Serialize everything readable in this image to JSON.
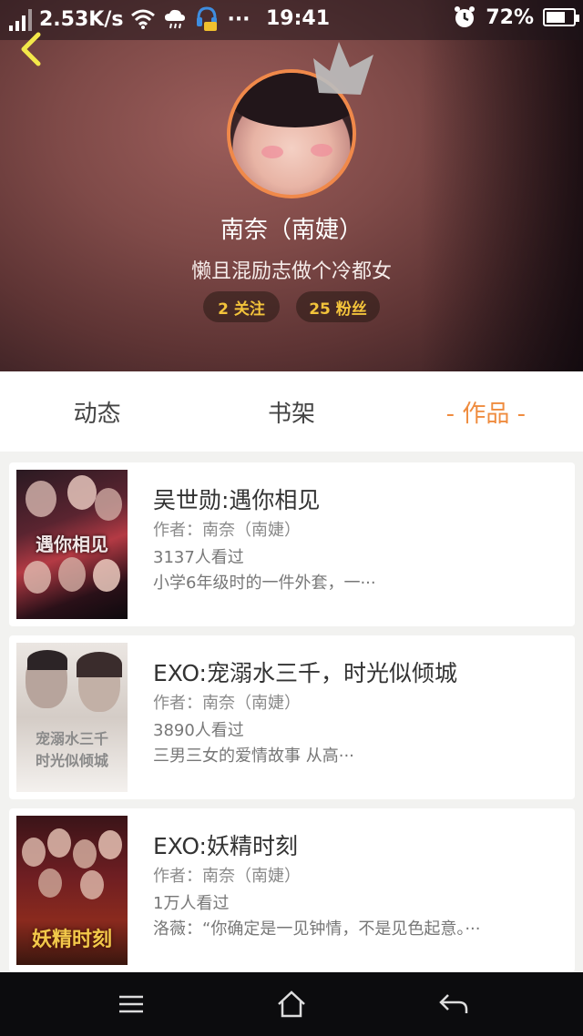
{
  "status": {
    "speed": "2.53K/s",
    "time": "19:41",
    "battery": "72%",
    "battery_level": 0.72,
    "dots": "···"
  },
  "profile": {
    "name": "南奈（南婕）",
    "bio": "懒且混励志做个冷都女",
    "follow_label": "2 关注",
    "fans_label": "25 粉丝"
  },
  "tabs": [
    {
      "label": "动态"
    },
    {
      "label": "书架"
    },
    {
      "label": "- 作品 -"
    }
  ],
  "books": [
    {
      "title": "吴世勋:遇你相见",
      "author": "作者：南奈（南婕）",
      "reads": "3137人看过",
      "desc": "小学6年级时的一件外套，一···",
      "cover_text": "遇你相见"
    },
    {
      "title": "EXO:宠溺水三千，时光似倾城",
      "author": "作者：南奈（南婕）",
      "reads": "3890人看过",
      "desc": "三男三女的爱情故事 从高···",
      "cover_text_1": "宠溺水三千",
      "cover_text_2": "时光似倾城"
    },
    {
      "title": "EXO:妖精时刻",
      "author": "作者：南奈（南婕）",
      "reads": "1万人看过",
      "desc": "洛薇：“你确定是一见钟情，不是见色起意。···",
      "cover_text": "妖精时刻"
    }
  ],
  "colors": {
    "accent": "#ef8c3f",
    "pill_text": "#f3c33b",
    "avatar_ring": "#f0894a"
  },
  "icons": [
    "back-icon",
    "menu-icon",
    "home-icon",
    "return-icon",
    "wifi-icon",
    "cloud-icon",
    "alarm-icon",
    "battery-icon",
    "signal-icon",
    "crown-icon"
  ]
}
